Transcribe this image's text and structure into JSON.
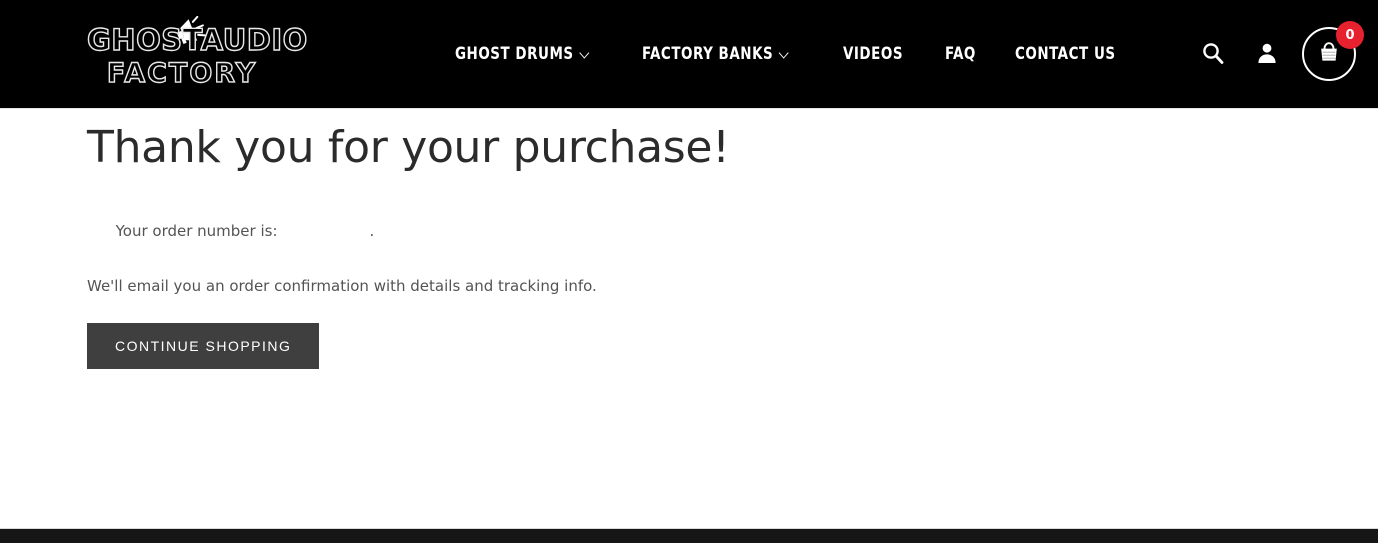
{
  "header": {
    "logo": {
      "line1": "GHOSTAUDIO",
      "line2": "FACTORY",
      "icon": "megaphone-icon"
    },
    "nav": [
      {
        "label": "GHOST DRUMS",
        "has_dropdown": true
      },
      {
        "label": "FACTORY BANKS",
        "has_dropdown": true
      },
      {
        "label": "VIDEOS",
        "has_dropdown": false
      },
      {
        "label": "FAQ",
        "has_dropdown": false
      },
      {
        "label": "CONTACT US",
        "has_dropdown": false
      }
    ],
    "actions": {
      "search_icon": "search-icon",
      "account_icon": "user-icon",
      "cart_icon": "shopping-bag-icon",
      "cart_count": "0",
      "badge_color": "#e8212f"
    }
  },
  "main": {
    "title": "Thank you for your purchase!",
    "order_label": "Your order number is:",
    "order_number": "",
    "order_suffix": ".",
    "email_note": "We'll email you an order confirmation with details and tracking info.",
    "continue_button": "Continue shopping",
    "button_color": "#3f3f3f"
  },
  "footer": {
    "background": "#161616"
  }
}
